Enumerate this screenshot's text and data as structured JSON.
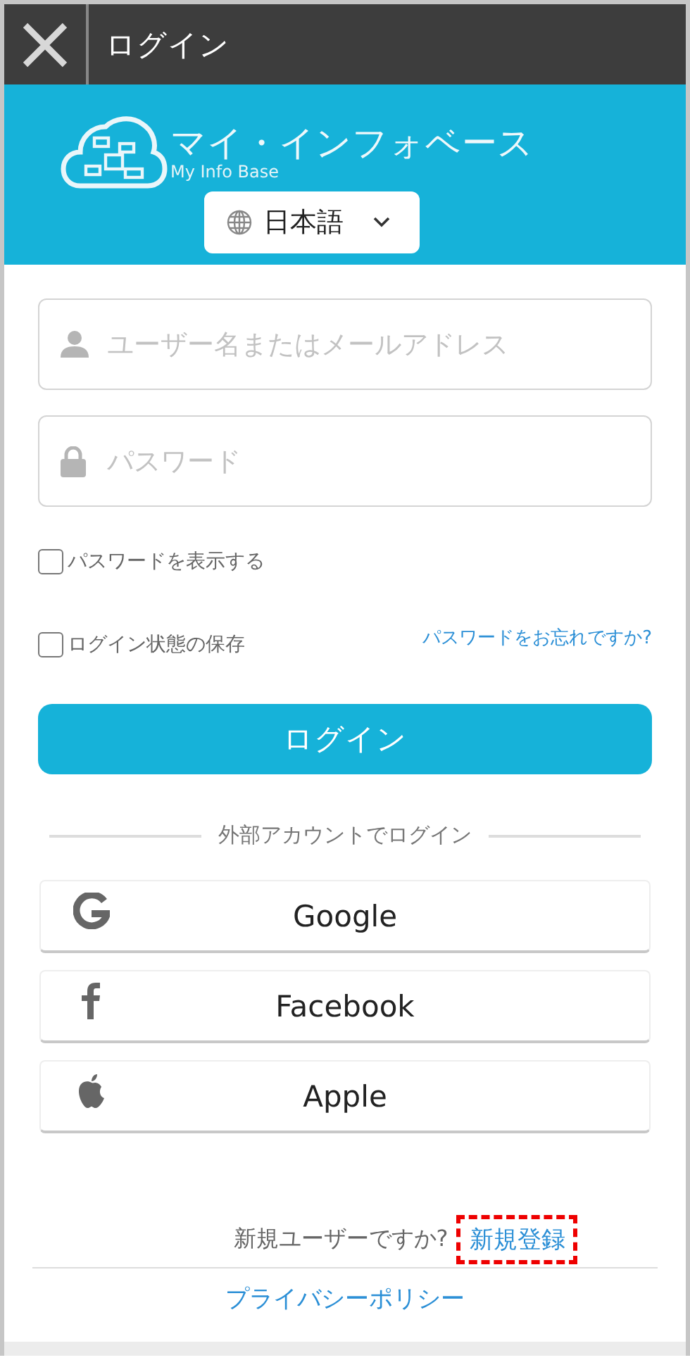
{
  "header": {
    "title": "ログイン"
  },
  "banner": {
    "app_name": "マイ・インフォベース",
    "app_name_en": "My Info Base",
    "language": "日本語"
  },
  "fields": [
    {
      "kind": "user",
      "placeholder": "ユーザー名またはメールアドレス"
    },
    {
      "kind": "password",
      "placeholder": "パスワード"
    }
  ],
  "checkboxes": [
    {
      "label": "パスワードを表示する",
      "checked": false
    },
    {
      "label": "ログイン状態の保存",
      "checked": false
    }
  ],
  "forgot_link": "パスワードをお忘れですか?",
  "login_button": "ログイン",
  "divider_label": "外部アカウントでログイン",
  "social_buttons": [
    {
      "kind": "google",
      "label": "Google"
    },
    {
      "kind": "facebook",
      "label": "Facebook"
    },
    {
      "kind": "apple",
      "label": "Apple"
    }
  ],
  "signup": {
    "prompt": "新規ユーザーですか?",
    "link": "新規登録",
    "highlighted": true
  },
  "privacy_link": "プライバシーポリシー"
}
